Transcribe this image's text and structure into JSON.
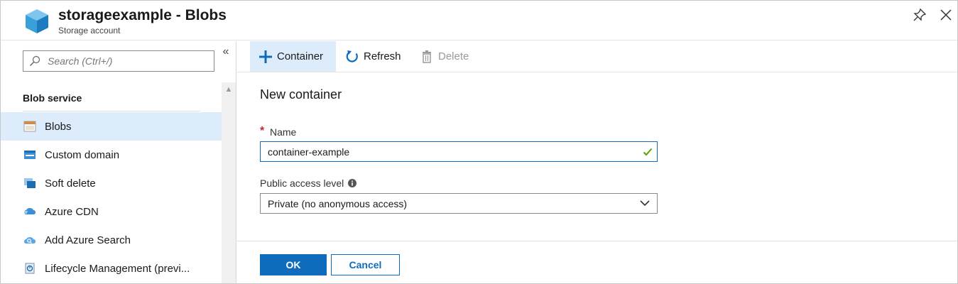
{
  "header": {
    "title": "storageexample - Blobs",
    "subtitle": "Storage account",
    "logo_icon": "storage-cube-icon",
    "pin_icon": "pin-icon",
    "close_icon": "close-icon"
  },
  "sidebar": {
    "search_placeholder": "Search (Ctrl+/)",
    "collapse_label": "«",
    "section_title": "Blob service",
    "items": [
      {
        "label": "Blobs",
        "icon": "blobs-icon",
        "active": true
      },
      {
        "label": "Custom domain",
        "icon": "custom-domain-icon",
        "active": false
      },
      {
        "label": "Soft delete",
        "icon": "soft-delete-icon",
        "active": false
      },
      {
        "label": "Azure CDN",
        "icon": "azure-cdn-icon",
        "active": false
      },
      {
        "label": "Add Azure Search",
        "icon": "azure-search-icon",
        "active": false
      },
      {
        "label": "Lifecycle Management (previ...",
        "icon": "lifecycle-icon",
        "active": false
      }
    ]
  },
  "toolbar": {
    "container_label": "Container",
    "refresh_label": "Refresh",
    "delete_label": "Delete"
  },
  "panel": {
    "title": "New container",
    "required_mark": "*",
    "name_label": "Name",
    "name_value": "container-example",
    "access_label": "Public access level",
    "access_value": "Private (no anonymous access)",
    "ok_label": "OK",
    "cancel_label": "Cancel"
  },
  "colors": {
    "accent": "#0f6cbd",
    "selected_bg": "#dcecfb",
    "valid_check": "#57a300",
    "required": "#c4262e"
  }
}
